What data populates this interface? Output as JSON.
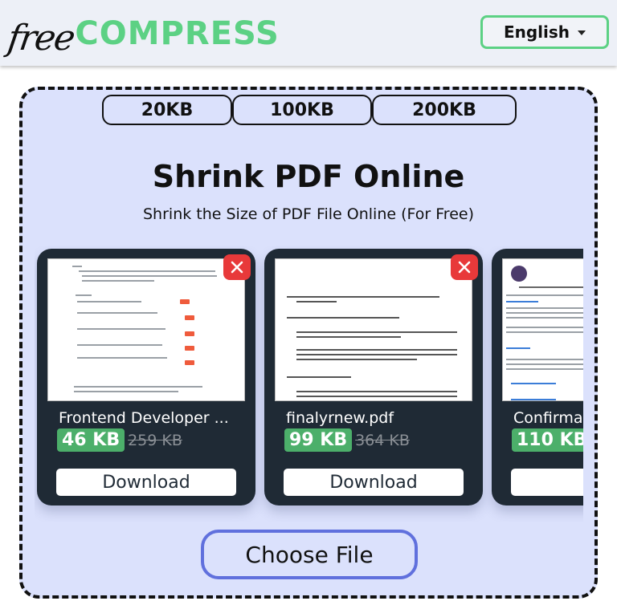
{
  "header": {
    "logo_free": "free",
    "logo_compress": "COMPRESS",
    "language": "English"
  },
  "presets": [
    "20KB",
    "100KB",
    "200KB"
  ],
  "hero": {
    "title": "Shrink PDF Online",
    "subtitle": "Shrink the Size of PDF File Online (For Free)"
  },
  "files": [
    {
      "name": "Frontend Developer ...",
      "compressed_size": "46 KB",
      "original_size": "259 KB",
      "download_label": "Download"
    },
    {
      "name": "finalyrnew.pdf",
      "compressed_size": "99 KB",
      "original_size": "364 KB",
      "download_label": "Download"
    },
    {
      "name": "Confirma",
      "compressed_size": "110 KB",
      "original_size": "",
      "download_label": "Dov"
    }
  ],
  "choose_file_label": "Choose File",
  "colors": {
    "brand_green": "#5cd184",
    "card_bg": "#1f2a35",
    "dropzone_bg": "#dbe1fc",
    "close_red": "#e8393a",
    "size_badge_green": "#4caf6a",
    "choose_border": "#6070dd"
  }
}
